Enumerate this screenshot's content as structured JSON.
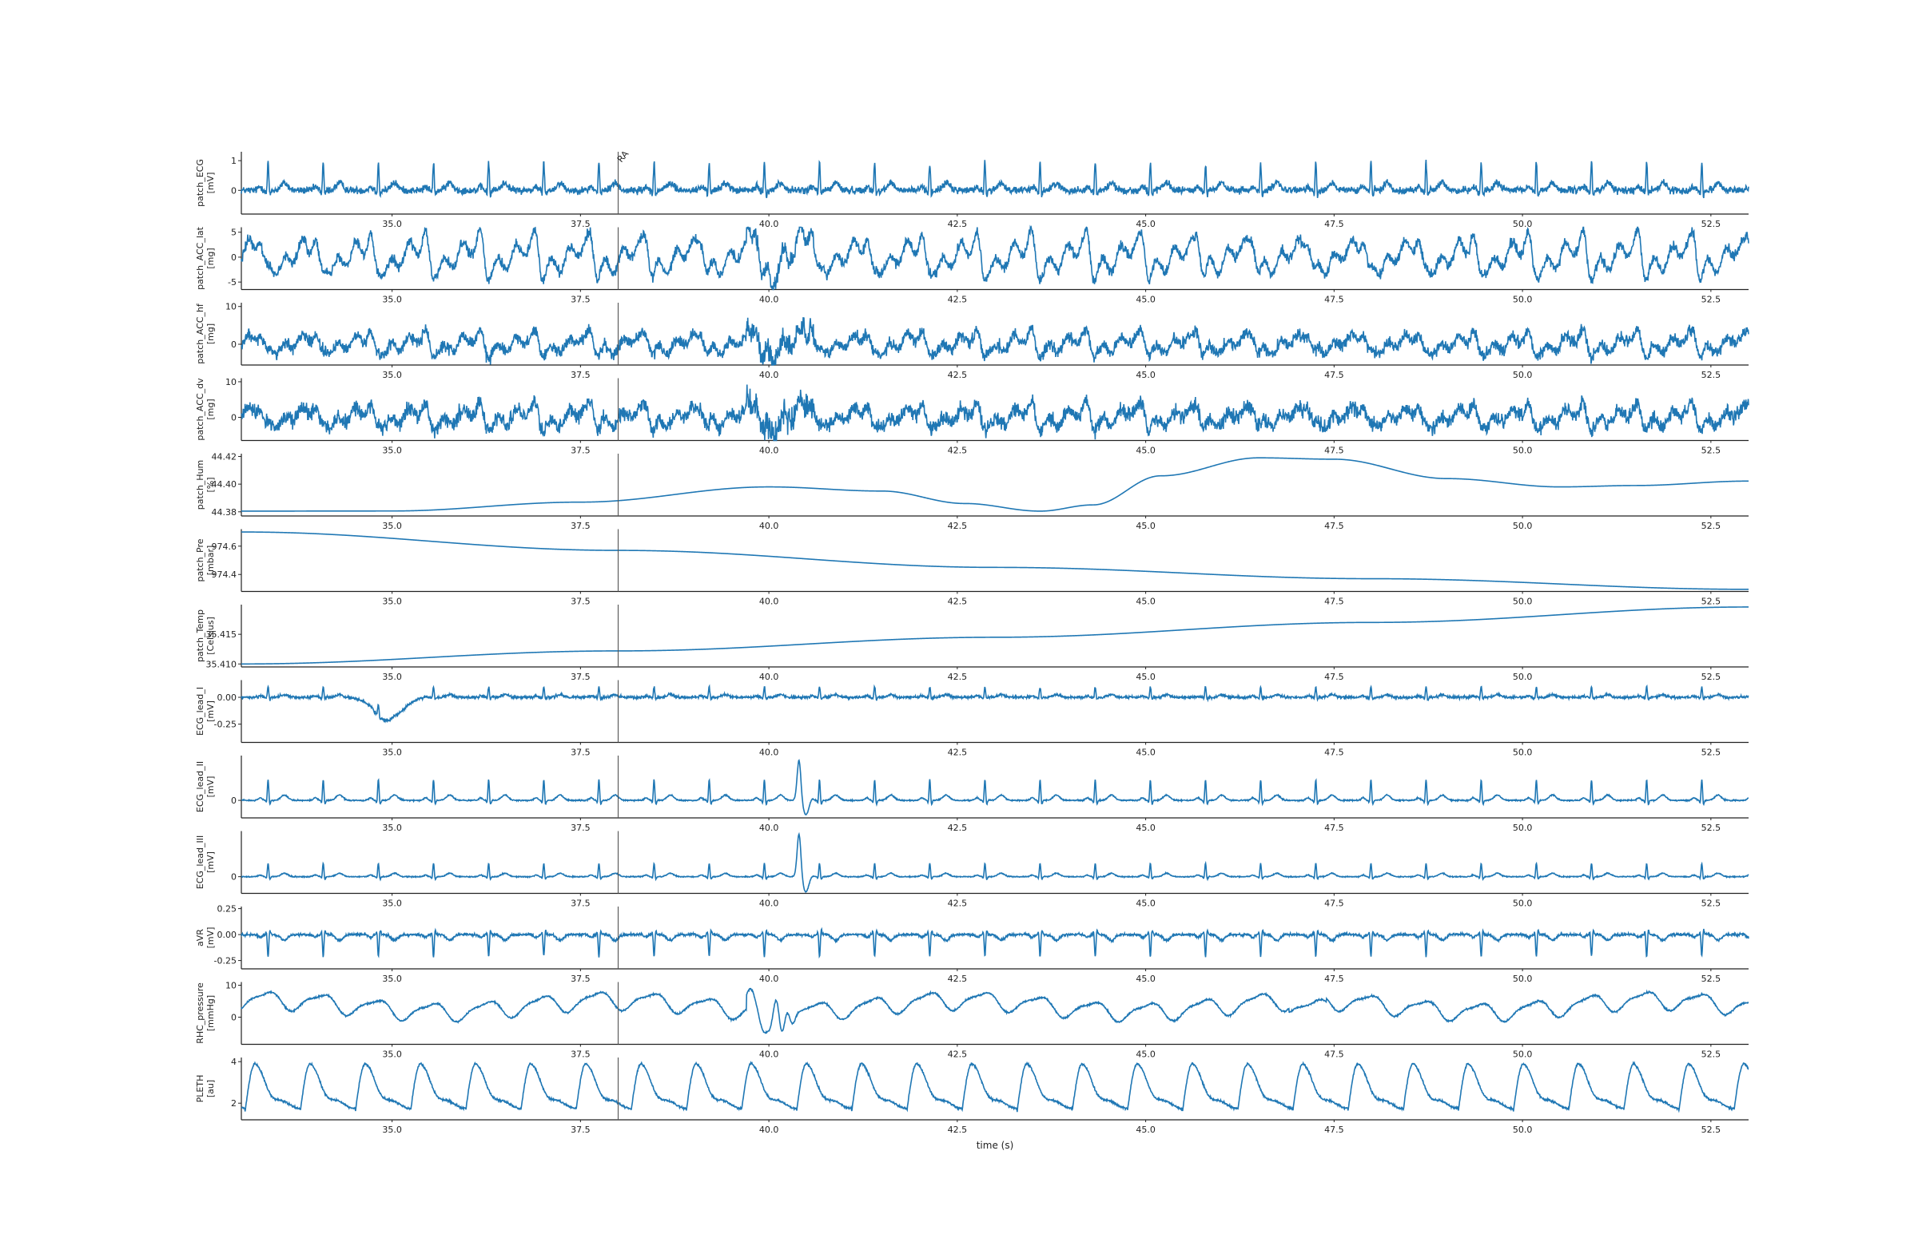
{
  "chart_data": {
    "type": "line",
    "xlabel": "time (s)",
    "xlim": [
      33.0,
      53.0
    ],
    "x_ticks": [
      35.0,
      37.5,
      40.0,
      42.5,
      45.0,
      47.5,
      50.0,
      52.5
    ],
    "x_tick_labels": [
      "35.0",
      "37.5",
      "40.0",
      "42.5",
      "45.0",
      "47.5",
      "50.0",
      "52.5"
    ],
    "grid": false,
    "line_color": "#1f77b4",
    "event": {
      "x": 38.0,
      "label": "RA"
    },
    "panels": [
      {
        "name": "patch_ECG",
        "unit": "[mV]",
        "ylim": [
          -0.8,
          1.3
        ],
        "yticks": [
          0,
          1
        ],
        "ytick_labels": [
          "0",
          "1"
        ],
        "signal": {
          "kind": "ecg",
          "hr": 82,
          "baseline": 0.0,
          "amp": 1.0,
          "noise": 0.12
        }
      },
      {
        "name": "patch_ACC_lat",
        "unit": "[mg]",
        "ylim": [
          -6.5,
          6.0
        ],
        "yticks": [
          -5,
          0,
          5
        ],
        "ytick_labels": [
          "-5",
          "0",
          "5"
        ],
        "signal": {
          "kind": "acc",
          "hr": 82,
          "amp": 3.2,
          "noise": 1.0
        }
      },
      {
        "name": "patch_ACC_hf",
        "unit": "[mg]",
        "ylim": [
          -5.5,
          11.0
        ],
        "yticks": [
          0,
          10
        ],
        "ytick_labels": [
          "0",
          "10"
        ],
        "signal": {
          "kind": "acc",
          "hr": 82,
          "amp": 2.4,
          "noise": 1.6
        }
      },
      {
        "name": "patch_ACC_dv",
        "unit": "[mg]",
        "ylim": [
          -6.5,
          11.0
        ],
        "yticks": [
          0,
          10
        ],
        "ytick_labels": [
          "0",
          "10"
        ],
        "signal": {
          "kind": "acc",
          "hr": 82,
          "amp": 2.6,
          "noise": 2.0
        }
      },
      {
        "name": "patch_Hum",
        "unit": "[%]",
        "ylim": [
          44.377,
          44.422
        ],
        "yticks": [
          44.38,
          44.4,
          44.42
        ],
        "ytick_labels": [
          "44.38",
          "44.40",
          "44.42"
        ],
        "signal": {
          "kind": "curve",
          "points": [
            [
              33.0,
              44.3805
            ],
            [
              35.0,
              44.3806
            ],
            [
              37.5,
              44.387
            ],
            [
              40.0,
              44.398
            ],
            [
              41.5,
              44.395
            ],
            [
              42.6,
              44.386
            ],
            [
              43.6,
              44.3805
            ],
            [
              44.3,
              44.385
            ],
            [
              45.2,
              44.406
            ],
            [
              46.5,
              44.419
            ],
            [
              47.5,
              44.418
            ],
            [
              49.0,
              44.404
            ],
            [
              50.5,
              44.398
            ],
            [
              51.5,
              44.399
            ],
            [
              53.0,
              44.4022
            ]
          ]
        }
      },
      {
        "name": "patch_Pre",
        "unit": "[mbar]",
        "ylim": [
          974.28,
          974.72
        ],
        "yticks": [
          974.4,
          974.6
        ],
        "ytick_labels": [
          "974.4",
          "974.6"
        ],
        "signal": {
          "kind": "curve",
          "points": [
            [
              33.0,
              974.7
            ],
            [
              38.0,
              974.57
            ],
            [
              43.0,
              974.45
            ],
            [
              48.0,
              974.37
            ],
            [
              53.0,
              974.295
            ]
          ]
        }
      },
      {
        "name": "patch_Temp",
        "unit": "[Celsius]",
        "ylim": [
          35.4095,
          35.42
        ],
        "yticks": [
          35.41,
          35.415
        ],
        "ytick_labels": [
          "35.410",
          "35.415"
        ],
        "signal": {
          "kind": "curve",
          "points": [
            [
              33.0,
              35.41
            ],
            [
              38.0,
              35.4122
            ],
            [
              43.0,
              35.4145
            ],
            [
              48.0,
              35.417
            ],
            [
              53.0,
              35.4196
            ]
          ]
        }
      },
      {
        "name": "ECG_lead_I",
        "unit": "[mV]",
        "ylim": [
          -0.42,
          0.16
        ],
        "yticks": [
          -0.25,
          0.0
        ],
        "ytick_labels": [
          "-0.25",
          "0.00"
        ],
        "signal": {
          "kind": "ecg",
          "hr": 82,
          "baseline": 0.0,
          "amp": 0.1,
          "noise": 0.012,
          "dip": [
            34.8,
            35.1,
            -0.22
          ]
        }
      },
      {
        "name": "ECG_lead_II",
        "unit": "[mV]",
        "ylim": [
          -0.45,
          1.15
        ],
        "yticks": [
          0
        ],
        "ytick_labels": [
          "0"
        ],
        "signal": {
          "kind": "ecg",
          "hr": 82,
          "baseline": 0.0,
          "amp": 0.55,
          "noise": 0.015,
          "spike": [
            40.4,
            1.05
          ]
        }
      },
      {
        "name": "ECG_lead_III",
        "unit": "[mV]",
        "ylim": [
          -0.42,
          1.15
        ],
        "yticks": [
          0
        ],
        "ytick_labels": [
          "0"
        ],
        "signal": {
          "kind": "ecg",
          "hr": 82,
          "baseline": 0.0,
          "amp": 0.35,
          "noise": 0.012,
          "spike": [
            40.4,
            1.1
          ]
        }
      },
      {
        "name": "aVR",
        "unit": "[mV]",
        "ylim": [
          -0.33,
          0.27
        ],
        "yticks": [
          -0.25,
          0.0,
          0.25
        ],
        "ytick_labels": [
          "-0.25",
          "0.00",
          "0.25"
        ],
        "signal": {
          "kind": "ecg",
          "hr": 82,
          "baseline": 0.0,
          "amp": -0.22,
          "noise": 0.012
        }
      },
      {
        "name": "RHC_pressure",
        "unit": "[mmHg]",
        "ylim": [
          -8.5,
          11.0
        ],
        "yticks": [
          0,
          10
        ],
        "ytick_labels": [
          "0",
          "10"
        ],
        "signal": {
          "kind": "pressure",
          "hr": 82,
          "amp": 2.6,
          "baseline": 3.5,
          "artifact": [
            39.7,
            40.3
          ]
        }
      },
      {
        "name": "PLETH",
        "unit": "[au]",
        "ylim": [
          1.2,
          4.2
        ],
        "yticks": [
          2,
          4
        ],
        "ytick_labels": [
          "2",
          "4"
        ],
        "signal": {
          "kind": "pleth",
          "hr": 82,
          "low": 1.6,
          "high": 3.9
        }
      }
    ]
  }
}
